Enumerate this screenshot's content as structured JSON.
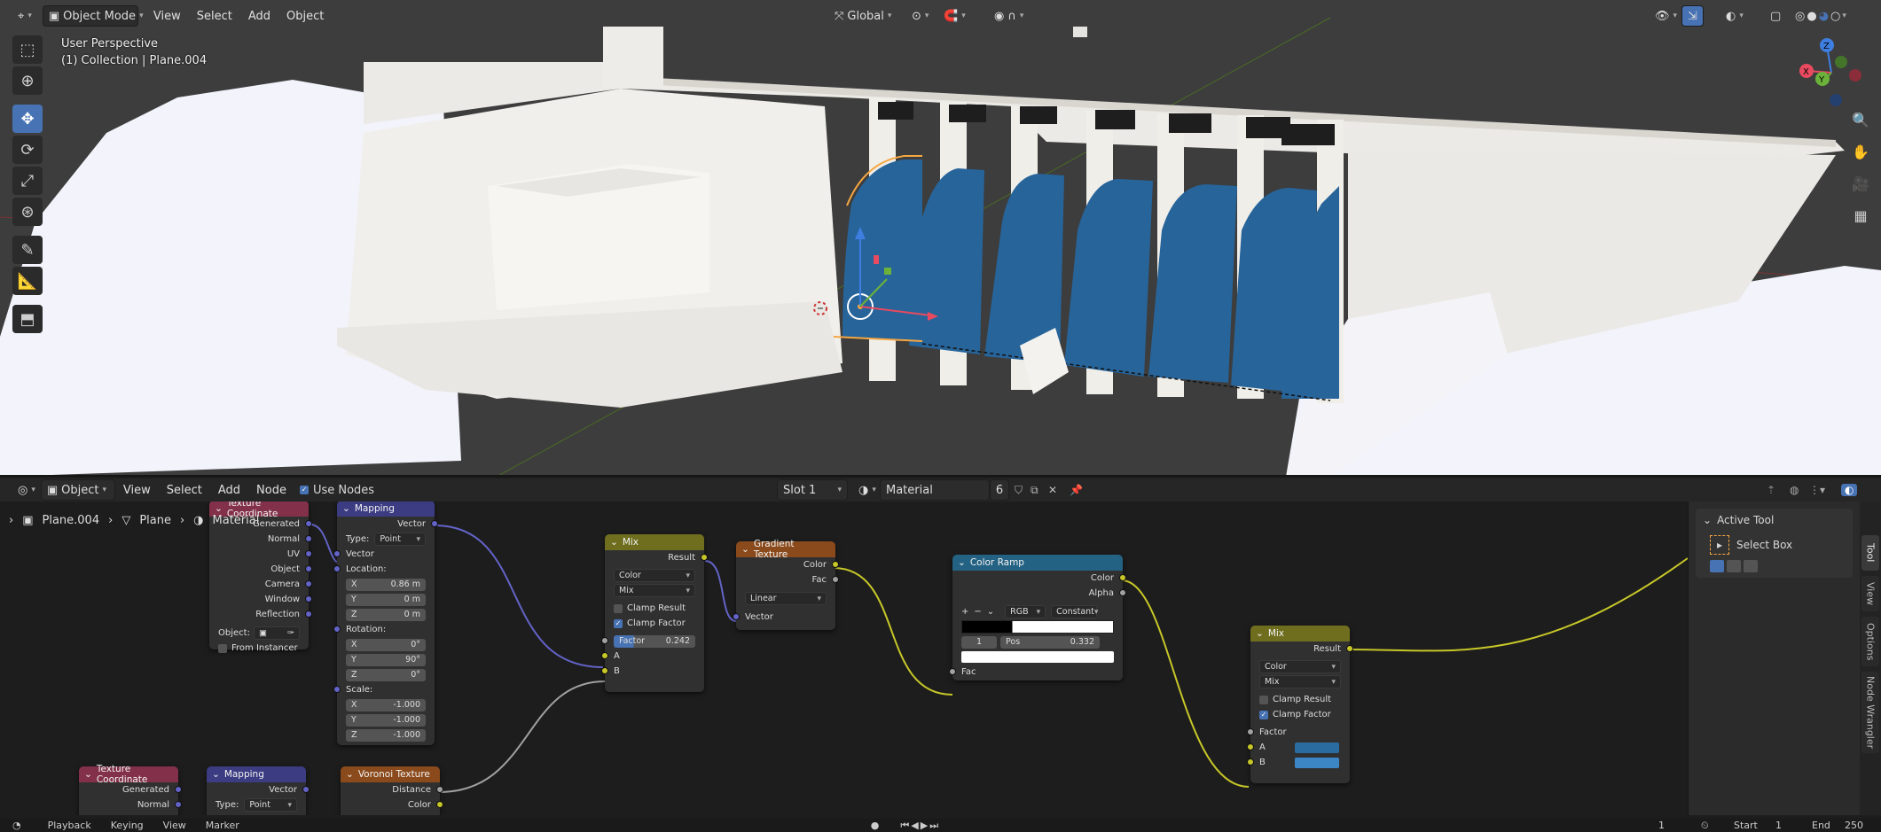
{
  "viewport_header": {
    "mode": "Object Mode",
    "menu": [
      "View",
      "Select",
      "Add",
      "Object"
    ],
    "transform_orientation": "Global"
  },
  "viewport_overlay": {
    "perspective": "User Perspective",
    "collection": "(1) Collection | Plane.004"
  },
  "node_header": {
    "object_dropdown": "Object",
    "menu": [
      "View",
      "Select",
      "Add",
      "Node"
    ],
    "use_nodes_label": "Use Nodes",
    "slot": "Slot 1",
    "material_name": "Material",
    "user_count": "6"
  },
  "breadcrumb": [
    "Plane.004",
    "Plane",
    "Material"
  ],
  "nodes": {
    "texcoord1": {
      "title": "Texture Coordinate",
      "outputs": [
        "Generated",
        "Normal",
        "UV",
        "Object",
        "Camera",
        "Window",
        "Reflection"
      ],
      "object_label": "Object:",
      "from_instancer": "From Instancer"
    },
    "mapping1": {
      "title": "Mapping",
      "out": "Vector",
      "type_label": "Type:",
      "type_value": "Point",
      "vector": "Vector",
      "location_label": "Location:",
      "location": [
        [
          "X",
          "0.86 m"
        ],
        [
          "Y",
          "0 m"
        ],
        [
          "Z",
          "0 m"
        ]
      ],
      "rotation_label": "Rotation:",
      "rotation": [
        [
          "X",
          "0°"
        ],
        [
          "Y",
          "90°"
        ],
        [
          "Z",
          "0°"
        ]
      ],
      "scale_label": "Scale:",
      "scale": [
        [
          "X",
          "-1.000"
        ],
        [
          "Y",
          "-1.000"
        ],
        [
          "Z",
          "-1.000"
        ]
      ]
    },
    "mix1": {
      "title": "Mix",
      "result": "Result",
      "dd1": "Color",
      "dd2": "Mix",
      "clamp_result": "Clamp Result",
      "clamp_factor": "Clamp Factor",
      "factor_label": "Factor",
      "factor_value": "0.242",
      "a": "A",
      "b": "B"
    },
    "gradient": {
      "title": "Gradient Texture",
      "color": "Color",
      "fac": "Fac",
      "type": "Linear",
      "vector": "Vector"
    },
    "colorramp": {
      "title": "Color Ramp",
      "color": "Color",
      "alpha": "Alpha",
      "mode": "RGB",
      "interp": "Constant",
      "index": "1",
      "pos_label": "Pos",
      "pos_value": "0.332",
      "fac": "Fac"
    },
    "mix2": {
      "title": "Mix",
      "result": "Result",
      "dd1": "Color",
      "dd2": "Mix",
      "clamp_result": "Clamp Result",
      "clamp_factor": "Clamp Factor",
      "factor": "Factor",
      "a": "A",
      "b": "B"
    },
    "texcoord2": {
      "title": "Texture Coordinate",
      "outputs": [
        "Generated",
        "Normal"
      ]
    },
    "mapping2": {
      "title": "Mapping",
      "out": "Vector",
      "type_label": "Type:",
      "type_value": "Point"
    },
    "voronoi": {
      "title": "Voronoi Texture",
      "outputs": [
        "Distance",
        "Color"
      ]
    }
  },
  "npanel": {
    "section": "Active Tool",
    "tool_name": "Select Box",
    "tabs": [
      "Tool",
      "View",
      "Options",
      "Node Wrangler"
    ]
  },
  "status_bar": {
    "items": [
      "Playback",
      "Keying",
      "View",
      "Marker"
    ],
    "current_frame": "1",
    "start_label": "Start",
    "start": "1",
    "end_label": "End",
    "end": "250"
  },
  "colors": {
    "accent": "#4772b3",
    "water": "#2b6ca0",
    "selection_outline": "#f5a742",
    "mix_header": "#6f6e1f",
    "texture_header": "#8b4a1b",
    "input_header": "#83314a",
    "vector_header": "#3c3c83",
    "converter_header": "#246283"
  }
}
